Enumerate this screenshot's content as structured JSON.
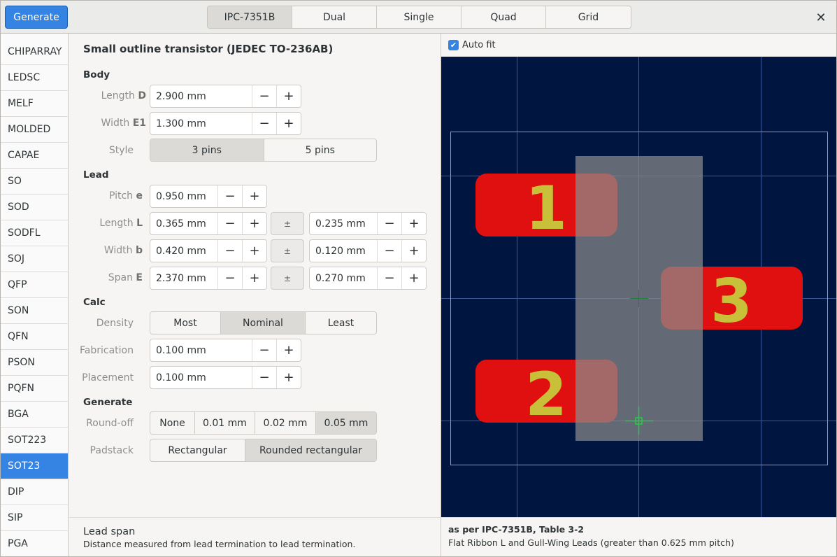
{
  "header": {
    "generate_label": "Generate",
    "tabs": [
      "IPC-7351B",
      "Dual",
      "Single",
      "Quad",
      "Grid"
    ],
    "active_tab": "IPC-7351B",
    "close_symbol": "✕"
  },
  "sidebar": {
    "items": [
      "CHIPARRAY",
      "LEDSC",
      "MELF",
      "MOLDED",
      "CAPAE",
      "SO",
      "SOD",
      "SODFL",
      "SOJ",
      "QFP",
      "SON",
      "QFN",
      "PSON",
      "PQFN",
      "BGA",
      "SOT223",
      "SOT23",
      "DIP",
      "SIP",
      "PGA"
    ],
    "active": "SOT23"
  },
  "form": {
    "title": "Small outline transistor (JEDEC TO-236AB)",
    "body": {
      "heading": "Body",
      "length_label": "Length",
      "length_sym": "D",
      "length_value": "2.900 mm",
      "width_label": "Width",
      "width_sym": "E1",
      "width_value": "1.300 mm",
      "style_label": "Style",
      "style_options": [
        "3 pins",
        "5 pins"
      ],
      "style_selected": "3 pins"
    },
    "lead": {
      "heading": "Lead",
      "pitch_label": "Pitch",
      "pitch_sym": "e",
      "pitch_value": "0.950 mm",
      "length_label": "Length",
      "length_sym": "L",
      "length_value": "0.365 mm",
      "length_tol": "0.235 mm",
      "width_label": "Width",
      "width_sym": "b",
      "width_value": "0.420 mm",
      "width_tol": "0.120 mm",
      "span_label": "Span",
      "span_sym": "E",
      "span_value": "2.370 mm",
      "span_tol": "0.270 mm",
      "tol_symbol": "±"
    },
    "calc": {
      "heading": "Calc",
      "density_label": "Density",
      "density_options": [
        "Most",
        "Nominal",
        "Least"
      ],
      "density_selected": "Nominal",
      "fabrication_label": "Fabrication",
      "fabrication_value": "0.100 mm",
      "placement_label": "Placement",
      "placement_value": "0.100 mm"
    },
    "generate": {
      "heading": "Generate",
      "roundoff_label": "Round-off",
      "roundoff_options": [
        "None",
        "0.01 mm",
        "0.02 mm",
        "0.05 mm"
      ],
      "roundoff_selected": "0.05 mm",
      "padstack_label": "Padstack",
      "padstack_options": [
        "Rectangular",
        "Rounded rectangular"
      ],
      "padstack_selected": "Rounded rectangular"
    },
    "minus": "−",
    "plus": "+"
  },
  "status_left": {
    "title": "Lead span",
    "description": "Distance measured from lead termination to lead termination."
  },
  "preview": {
    "autofit_label": "Auto fit",
    "autofit_checked": true,
    "pads": [
      "1",
      "2",
      "3"
    ],
    "colors": {
      "background": "#001540",
      "pad": "#e01010",
      "pad_label": "#c8c038",
      "body": "#808080",
      "grid": "#3a5a9a",
      "origin": "#20d040"
    }
  },
  "status_right": {
    "title": "as per IPC-7351B, Table 3-2",
    "description": "Flat Ribbon L and Gull-Wing Leads (greater than 0.625 mm pitch)"
  }
}
